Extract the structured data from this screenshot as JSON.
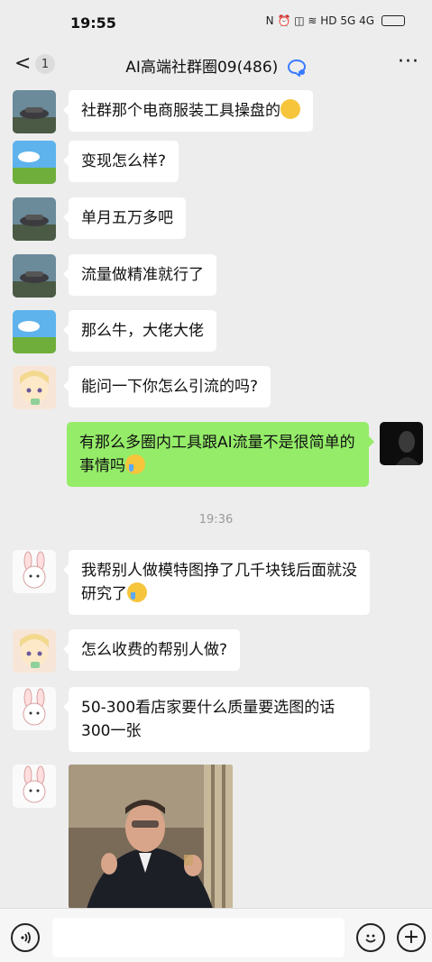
{
  "status": {
    "time": "19:55",
    "icons_text": "N ⏰ ◫ ≋ HD 5G 4G",
    "battery": "battery-icon"
  },
  "nav": {
    "back": "<",
    "unread": "1",
    "title": "AI高端社群圈09(486)",
    "more": "···"
  },
  "messages": [
    {
      "side": "left",
      "avatar": "car",
      "text": "社群那个电商服装工具操盘的",
      "emoji": "smirk"
    },
    {
      "side": "left",
      "avatar": "landscape",
      "text": "变现怎么样?"
    },
    {
      "side": "left",
      "avatar": "car",
      "text": "单月五万多吧"
    },
    {
      "side": "left",
      "avatar": "car",
      "text": "流量做精准就行了"
    },
    {
      "side": "left",
      "avatar": "landscape",
      "text": "那么牛，大佬大佬"
    },
    {
      "side": "left",
      "avatar": "anime-girl",
      "text": "能问一下你怎么引流的吗?"
    },
    {
      "side": "right",
      "avatar": "dark-portrait",
      "text": "有那么多圈内工具跟AI流量不是很简单的事情吗",
      "emoji": "cry"
    },
    {
      "side": "left",
      "avatar": "bunny",
      "text": "我帮别人做模特图挣了几千块钱后面就没研究了",
      "emoji": "cry"
    },
    {
      "side": "left",
      "avatar": "anime-girl",
      "text": "怎么收费的帮别人做?"
    },
    {
      "side": "left",
      "avatar": "bunny",
      "text": "50-300看店家要什么质量要选图的话300一张"
    },
    {
      "side": "left",
      "avatar": "bunny",
      "image": "man-in-suit-gesturing-photo"
    }
  ],
  "timestamp": "19:36",
  "input": {
    "voice": "voice-icon",
    "emoji": "emoji-icon",
    "plus": "+"
  }
}
